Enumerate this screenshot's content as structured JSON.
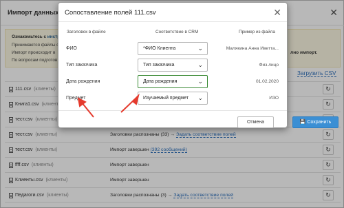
{
  "background": {
    "title": "Импорт данных из",
    "info": {
      "line1_prefix": "Ознакомьтесь с",
      "line1_link": "инстр",
      "line2": "Принимаются файлы с",
      "line3": "Импорт происходит в",
      "line4": "По вопросам подготов",
      "right_text": "лно импорт."
    },
    "upload_csv": "Загрузить CSV",
    "files": [
      {
        "name": "111.csv",
        "tag": "(клиенты)",
        "status": "",
        "link": ""
      },
      {
        "name": "Книга1.csv",
        "tag": "(клиенты)",
        "status": "",
        "link": ""
      },
      {
        "name": "тест.csv",
        "tag": "(клиенты)",
        "status": "",
        "link": ""
      },
      {
        "name": "тест.csv",
        "tag": "(клиенты)",
        "status": "Заголовки распознаны (33) →",
        "link": "Задать соответствие полей"
      },
      {
        "name": "тест.csv",
        "tag": "(клиенты)",
        "status": "Импорт завершен",
        "link": "(392 сообщений)"
      },
      {
        "name": "ffff.csv",
        "tag": "(клиенты)",
        "status": "Импорт завершен",
        "link": ""
      },
      {
        "name": "Клиенты.csv",
        "tag": "(клиенты)",
        "status": "Импорт завершен",
        "link": ""
      },
      {
        "name": "Педагоги.csv",
        "tag": "(клиенты)",
        "status": "Заголовки распознаны (3) →",
        "link": "Задать соответствие полей"
      }
    ]
  },
  "modal": {
    "title": "Сопоставление полей 111.csv",
    "col_file_header": "Заголовок в файле",
    "col_crm": "Соответствие в CRM",
    "col_example": "Пример из файла",
    "rows": [
      {
        "label": "ФИО",
        "value": "*ФИО Клиента",
        "example": "Малякина Анна Иветта...",
        "highlight": false
      },
      {
        "label": "Тип заказчика",
        "value": "Тип заказчика",
        "example": "Физ.лицо",
        "highlight": false
      },
      {
        "label": "Дата рождения",
        "value": "Дата рождения",
        "example": "01.02.2020",
        "highlight": true
      },
      {
        "label": "Предмет",
        "value": "Изучаемый предмет",
        "example": "ИЗО",
        "highlight": false
      }
    ],
    "cancel": "Отмена",
    "save": "Сохранить"
  },
  "colors": {
    "accent": "#3b8fd4",
    "link": "#2a6ebb",
    "arrow": "#e53b2e",
    "highlight": "#3a8a34"
  }
}
